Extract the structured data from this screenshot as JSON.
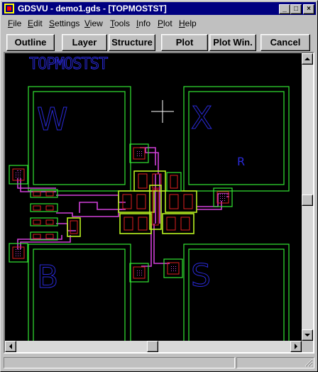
{
  "window": {
    "title": "GDSVU - demo1.gds - [TOPMOSTST]",
    "minimize_glyph": "_",
    "maximize_glyph": "□",
    "close_glyph": "×"
  },
  "menu": [
    {
      "key": "F",
      "rest": "ile"
    },
    {
      "key": "E",
      "rest": "dit"
    },
    {
      "key": "S",
      "rest": "ettings"
    },
    {
      "key": "V",
      "rest": "iew"
    },
    {
      "key": "T",
      "rest": "ools"
    },
    {
      "key": "I",
      "rest": "nfo"
    },
    {
      "key": "P",
      "rest": "lot"
    },
    {
      "key": "H",
      "rest": "elp"
    }
  ],
  "toolbar": {
    "outline": "Outline",
    "layer": "Layer",
    "structure": "Structure",
    "plot": "Plot",
    "plot_win": "Plot Win.",
    "cancel": "Cancel"
  },
  "layout": {
    "cell_name": "TOPMOSTST",
    "pad_labels": [
      "W",
      "X",
      "B",
      "S"
    ],
    "small_label": "R"
  },
  "colors": {
    "titlebar": "#000080",
    "canvas_bg": "#000000",
    "outline_green": "#33e633",
    "text_blue": "#2a2ad8",
    "poly_red": "#e02020",
    "metal_magenta": "#d040d8",
    "pad_yellow_green": "#b8f020"
  }
}
